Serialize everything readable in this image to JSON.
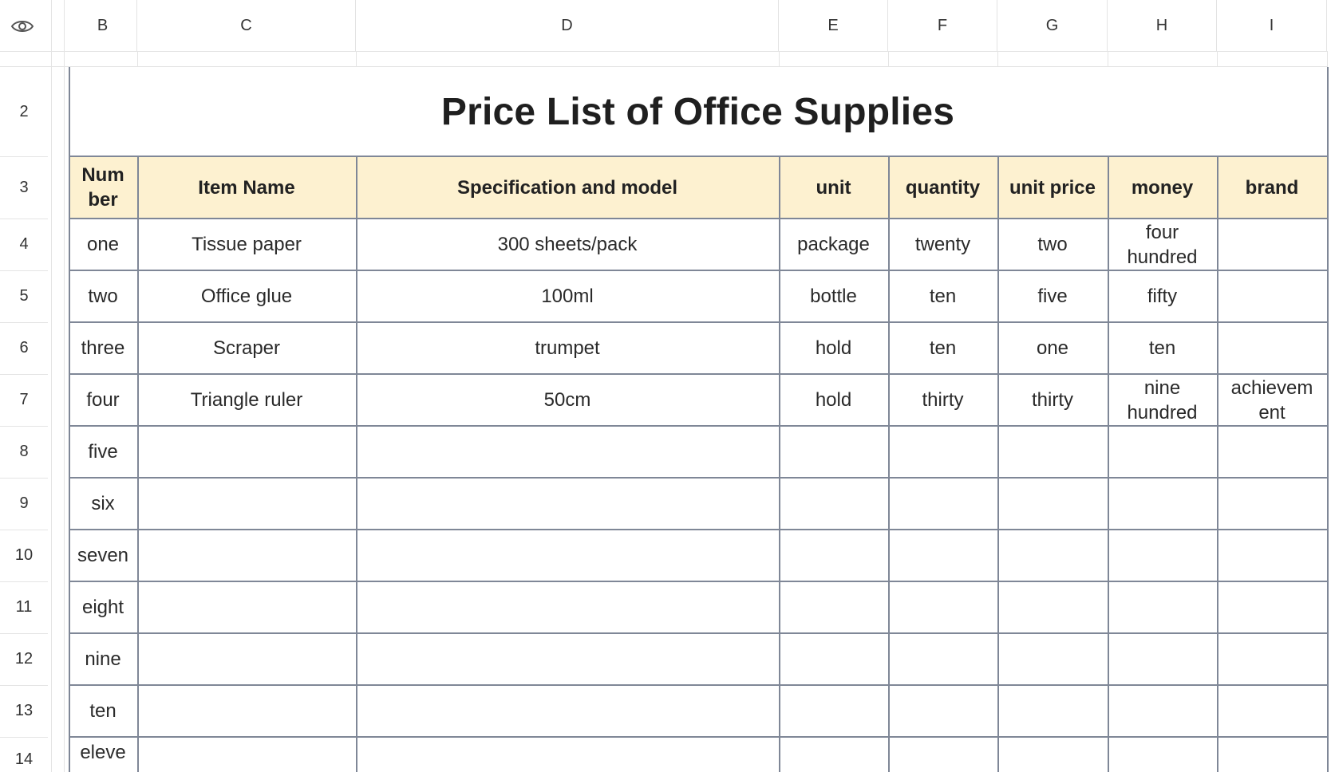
{
  "columns": [
    "B",
    "C",
    "D",
    "E",
    "F",
    "G",
    "H",
    "I"
  ],
  "rows": [
    "2",
    "3",
    "4",
    "5",
    "6",
    "7",
    "8",
    "9",
    "10",
    "11",
    "12",
    "13",
    "14"
  ],
  "title": "Price List of Office Supplies",
  "table": {
    "headers": [
      "Num ber",
      "Item Name",
      "Specification and model",
      "unit",
      "quantity",
      "unit price",
      "money",
      "brand"
    ],
    "rows": [
      [
        "one",
        "Tissue paper",
        "300 sheets/pack",
        "package",
        "twenty",
        "two",
        "four hundred",
        ""
      ],
      [
        "two",
        "Office glue",
        "100ml",
        "bottle",
        "ten",
        "five",
        "fifty",
        ""
      ],
      [
        "three",
        "Scraper",
        "trumpet",
        "hold",
        "ten",
        "one",
        "ten",
        ""
      ],
      [
        "four",
        "Triangle ruler",
        "50cm",
        "hold",
        "thirty",
        "thirty",
        "nine hundred",
        "achievem ent"
      ],
      [
        "five",
        "",
        "",
        "",
        "",
        "",
        "",
        ""
      ],
      [
        "six",
        "",
        "",
        "",
        "",
        "",
        "",
        ""
      ],
      [
        "seven",
        "",
        "",
        "",
        "",
        "",
        "",
        ""
      ],
      [
        "eight",
        "",
        "",
        "",
        "",
        "",
        "",
        ""
      ],
      [
        "nine",
        "",
        "",
        "",
        "",
        "",
        "",
        ""
      ],
      [
        "ten",
        "",
        "",
        "",
        "",
        "",
        "",
        ""
      ],
      [
        "eleve",
        "",
        "",
        "",
        "",
        "",
        "",
        ""
      ]
    ]
  },
  "icons": {
    "visibility": "eye-icon",
    "column_resize": "column-resize-icon"
  },
  "colors": {
    "header_fill": "#fdf1d0",
    "grid_line": "#7f8797",
    "light_line": "#e4e4e4"
  }
}
